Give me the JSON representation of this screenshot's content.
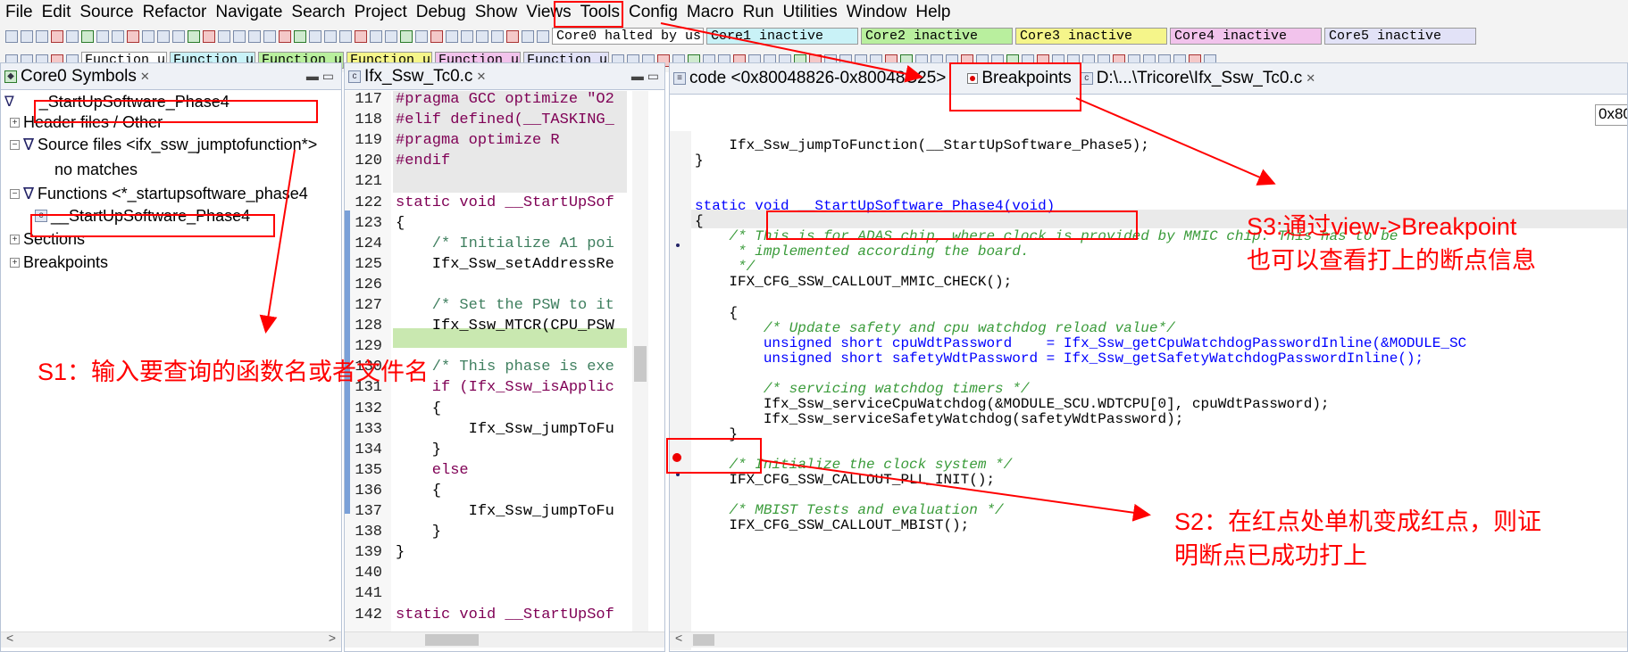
{
  "menu": [
    "File",
    "Edit",
    "Source",
    "Refactor",
    "Navigate",
    "Search",
    "Project",
    "Debug",
    "Show",
    "Views",
    "Tools",
    "Config",
    "Macro",
    "Run",
    "Utilities",
    "Window",
    "Help"
  ],
  "toolbar": {
    "cores": [
      {
        "label": "Core0 halted by us",
        "color": "#ffffff"
      },
      {
        "label": "Core1 inactive",
        "color": "#c9f2f7"
      },
      {
        "label": "Core2 inactive",
        "color": "#b9ef9e"
      },
      {
        "label": "Core3 inactive",
        "color": "#f5f58a"
      },
      {
        "label": "Core4 inactive",
        "color": "#f2c3ec"
      },
      {
        "label": "Core5 inactive",
        "color": "#e2e2f7"
      }
    ],
    "functions": [
      {
        "label": "Function u",
        "color": "#ffffff"
      },
      {
        "label": "Function u",
        "color": "#c9f2f7"
      },
      {
        "label": "Function u",
        "color": "#b9ef9e"
      },
      {
        "label": "Function u",
        "color": "#f5f58a"
      },
      {
        "label": "Function u",
        "color": "#f2c3ec"
      },
      {
        "label": "Function u",
        "color": "#e2e2f7"
      }
    ]
  },
  "symbols_panel": {
    "tab": "Core0 Symbols",
    "filter_value": "_StartUpSoftware_Phase4",
    "tree": [
      {
        "label": "Header files / Other",
        "kind": "plus"
      },
      {
        "label": "Source files <ifx_ssw_jumptofunction*>",
        "kind": "filter"
      },
      {
        "label": "no matches",
        "kind": "leaf"
      },
      {
        "label": "Functions <*_startupsoftware_phase4",
        "kind": "filter"
      },
      {
        "label": "__StartUpSoftware_Phase4",
        "kind": "file"
      },
      {
        "label": "Sections",
        "kind": "plus"
      },
      {
        "label": "Breakpoints",
        "kind": "plus"
      }
    ]
  },
  "source_panel": {
    "tab": "Ifx_Ssw_Tc0.c",
    "lines": [
      {
        "n": "117",
        "t": "#pragma GCC optimize \"O2"
      },
      {
        "n": "118",
        "t": "#elif defined(__TASKING_"
      },
      {
        "n": "119",
        "t": "#pragma optimize R"
      },
      {
        "n": "120",
        "t": "#endif"
      },
      {
        "n": "121",
        "t": ""
      },
      {
        "n": "122",
        "t": "static void __StartUpSof"
      },
      {
        "n": "123",
        "t": "{"
      },
      {
        "n": "124",
        "t": "    /* Initialize A1 poi"
      },
      {
        "n": "125",
        "t": "    Ifx_Ssw_setAddressRe"
      },
      {
        "n": "126",
        "t": ""
      },
      {
        "n": "127",
        "t": "    /* Set the PSW to it"
      },
      {
        "n": "128",
        "t": "    Ifx_Ssw_MTCR(CPU_PSW"
      },
      {
        "n": "129",
        "t": ""
      },
      {
        "n": "130",
        "t": "    /* This phase is exe"
      },
      {
        "n": "131",
        "t": "    if (Ifx_Ssw_isApplic"
      },
      {
        "n": "132",
        "t": "    {"
      },
      {
        "n": "133",
        "t": "        Ifx_Ssw_jumpToFu"
      },
      {
        "n": "134",
        "t": "    }"
      },
      {
        "n": "135",
        "t": "    else"
      },
      {
        "n": "136",
        "t": "    {"
      },
      {
        "n": "137",
        "t": "        Ifx_Ssw_jumpToFu"
      },
      {
        "n": "138",
        "t": "    }"
      },
      {
        "n": "139",
        "t": "}"
      },
      {
        "n": "140",
        "t": ""
      },
      {
        "n": "141",
        "t": ""
      },
      {
        "n": "142",
        "t": "static void __StartUpSof"
      }
    ]
  },
  "code_panel": {
    "tabs": [
      "code <0x80048826-0x80048C25>",
      "Breakpoints",
      "D:\\...\\Tricore\\Ifx_Ssw_Tc0.c"
    ],
    "address_field": "0x80",
    "lines": [
      "    Ifx_Ssw_jumpToFunction(__StartUpSoftware_Phase5);",
      "}",
      "",
      "",
      "static void __StartUpSoftware_Phase4(void)",
      "{",
      "    /* This is for ADAS chip, where clock is provided by MMIC chip. This has to be",
      "     * implemented according the board.",
      "     */",
      "    IFX_CFG_SSW_CALLOUT_MMIC_CHECK();",
      "",
      "    {",
      "        /* Update safety and cpu watchdog reload value*/",
      "        unsigned short cpuWdtPassword    = Ifx_Ssw_getCpuWatchdogPasswordInline(&MODULE_SC",
      "        unsigned short safetyWdtPassword = Ifx_Ssw_getSafetyWatchdogPasswordInline();",
      "",
      "        /* servicing watchdog timers */",
      "        Ifx_Ssw_serviceCpuWatchdog(&MODULE_SCU.WDTCPU[0], cpuWdtPassword);",
      "        Ifx_Ssw_serviceSafetyWatchdog(safetyWdtPassword);",
      "    }",
      "",
      "    /* Initialize the clock system */",
      "    IFX_CFG_SSW_CALLOUT_PLL_INIT();",
      "",
      "    /* MBIST Tests and evaluation */",
      "    IFX_CFG_SSW_CALLOUT_MBIST();"
    ]
  },
  "annotations": {
    "s1": "S1：输入要查询的函数名或者文件名",
    "s2_line1": "S2：在红点处单机变成红点，则证",
    "s2_line2": "明断点已成功打上",
    "s3_line1": "S3:通过view->Breakpoint",
    "s3_line2": "也可以查看打上的断点信息"
  },
  "colors": {
    "accent_red": "#ff0000",
    "keyword": "#7f0055",
    "comment": "#3f7f5f"
  }
}
